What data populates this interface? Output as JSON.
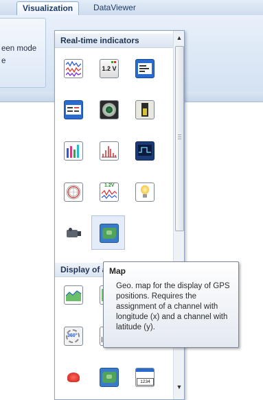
{
  "ribbon": {
    "tabs": [
      {
        "label": "Visualization",
        "active": true
      },
      {
        "label": "DataViewer",
        "active": false
      }
    ],
    "group_label_line1": "een mode",
    "group_label_line2": "e"
  },
  "panel": {
    "sections": [
      {
        "title": "Real-time indicators"
      },
      {
        "title": "Display of a"
      }
    ],
    "instruments": [
      {
        "icon": "recorder-icon"
      },
      {
        "icon": "numeric-indicator-icon",
        "label": "1.2 V"
      },
      {
        "icon": "text-display-icon"
      },
      {
        "icon": "channel-table-icon"
      },
      {
        "icon": "analog-meter-icon"
      },
      {
        "icon": "bar-indicator-icon"
      },
      {
        "icon": "multi-bar-icon"
      },
      {
        "icon": "spectrum-icon"
      },
      {
        "icon": "oscilloscope-icon"
      },
      {
        "icon": "polar-plot-icon"
      },
      {
        "icon": "combined-recorder-icon",
        "label": "1.2V"
      },
      {
        "icon": "lamp-icon"
      },
      {
        "icon": "video-icon"
      },
      {
        "icon": "map-icon"
      },
      {
        "icon": "area-chart-icon"
      },
      {
        "icon": "xy-chart-icon"
      },
      {
        "icon": "rotation-360-icon",
        "label": "360°"
      },
      {
        "icon": "scale-icon"
      },
      {
        "icon": "stripe-scale-icon"
      },
      {
        "icon": "car-icon"
      },
      {
        "icon": "map-icon"
      },
      {
        "icon": "value-table-icon",
        "label": "1234"
      }
    ]
  },
  "tooltip": {
    "title": "Map",
    "body": "Geo. map for the display of GPS positions. Requires the assignment of a channel with longitude (x) and a channel with latitude (y)."
  },
  "colors": {
    "accent": "#1d3b63",
    "tooltip_border": "#7a8496",
    "hover_tile": "#e3ecf8"
  }
}
